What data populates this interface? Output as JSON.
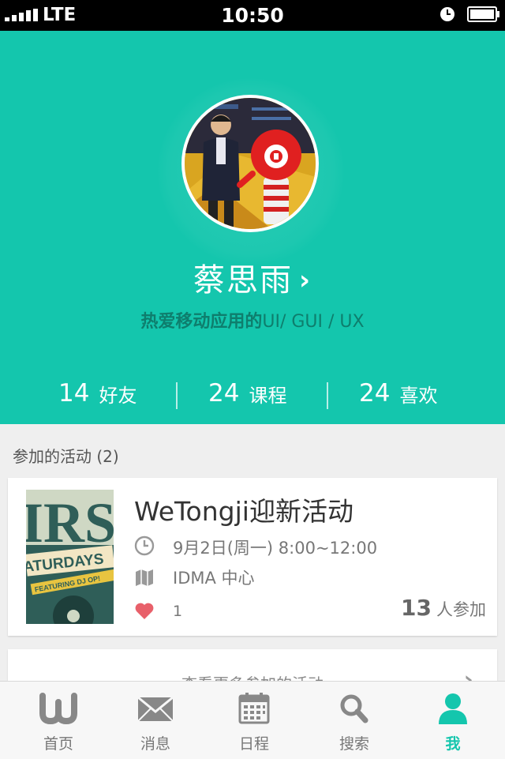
{
  "status_bar": {
    "carrier": "LTE",
    "time": "10:50"
  },
  "profile": {
    "name": "蔡思雨",
    "bio_cn": "热爱移动应用的",
    "bio_en": "UI/ GUI / UX",
    "stats": [
      {
        "value": "14",
        "label": "好友"
      },
      {
        "value": "24",
        "label": "课程"
      },
      {
        "value": "24",
        "label": "喜欢"
      }
    ]
  },
  "activities": {
    "section_title": "参加的活动 (2)",
    "event": {
      "title": "WeTongji迎新活动",
      "time": "9月2日(周一) 8:00~12:00",
      "location": "IDMA 中心",
      "likes": "1",
      "participants": "13",
      "participants_label": "人参加",
      "poster_text": {
        "big": "IRS",
        "sub": "ATURDAYS",
        "feat": "FEATURING DJ OP!"
      }
    },
    "more_label": "查看更多参加的活动"
  },
  "tab_bar": {
    "active_color": "#14c6ad",
    "inactive_color": "#777777",
    "tabs": [
      {
        "label": "首页",
        "icon": "w-logo-icon"
      },
      {
        "label": "消息",
        "icon": "envelope-icon"
      },
      {
        "label": "日程",
        "icon": "calendar-icon"
      },
      {
        "label": "搜索",
        "icon": "search-icon"
      },
      {
        "label": "我",
        "icon": "user-icon",
        "active": true
      }
    ]
  },
  "colors": {
    "accent": "#14c6ad",
    "heart": "#e8606a"
  }
}
